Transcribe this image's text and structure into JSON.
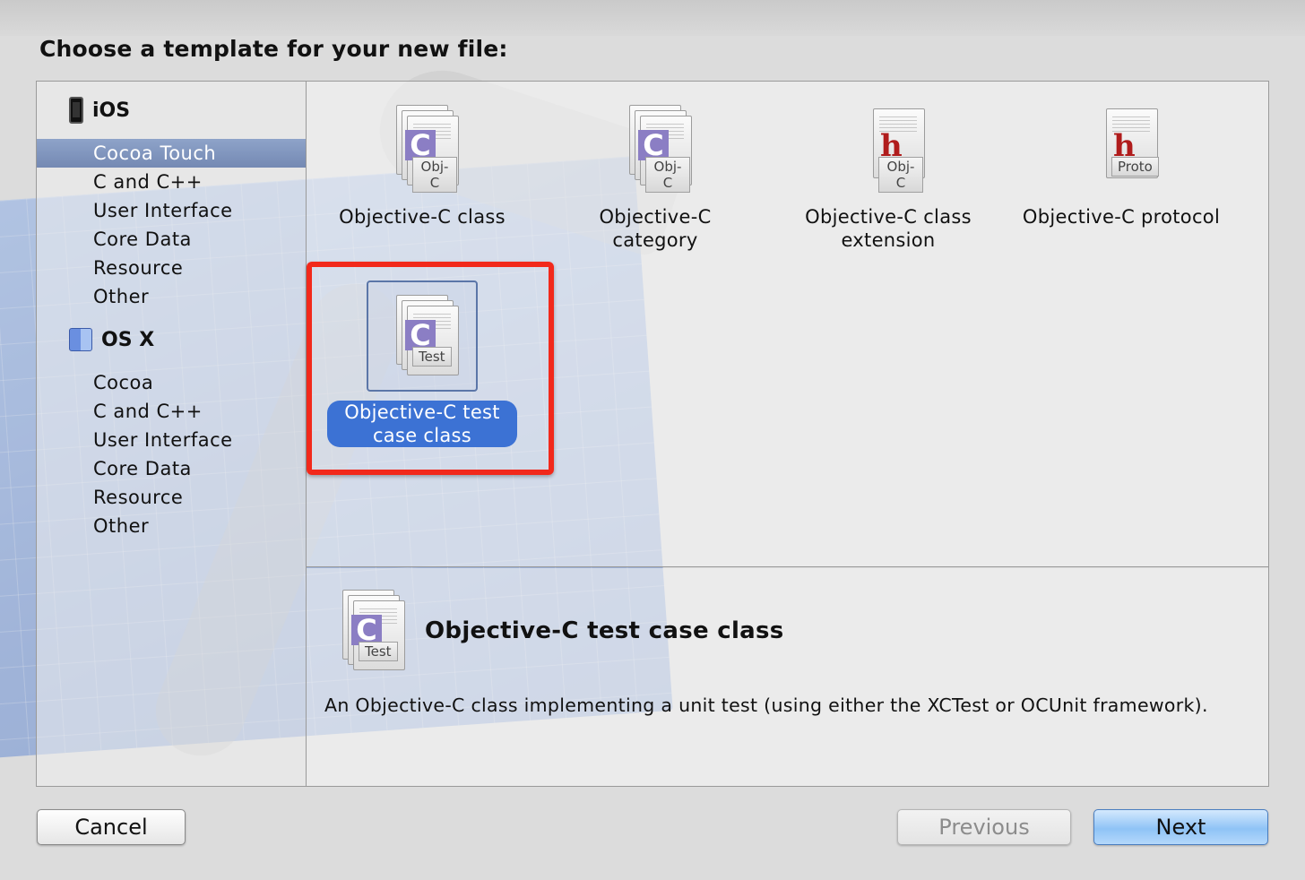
{
  "dialog": {
    "heading": "Choose a template for your new file:"
  },
  "sidebar": {
    "ios": {
      "label": "iOS",
      "items": [
        "Cocoa Touch",
        "C and C++",
        "User Interface",
        "Core Data",
        "Resource",
        "Other"
      ],
      "selected": "Cocoa Touch"
    },
    "osx": {
      "label": "OS X",
      "items": [
        "Cocoa",
        "C and C++",
        "User Interface",
        "Core Data",
        "Resource",
        "Other"
      ]
    }
  },
  "templates": [
    {
      "label": "Objective-C class",
      "icon_tag": "Obj-C",
      "icon": "objc-file-icon"
    },
    {
      "label": "Objective-C category",
      "icon_tag": "Obj-C",
      "icon": "objc-file-icon"
    },
    {
      "label": "Objective-C class extension",
      "icon_tag": "Obj-C",
      "icon": "header-file-icon"
    },
    {
      "label": "Objective-C protocol",
      "icon_tag": "Proto",
      "icon": "header-file-icon"
    },
    {
      "label": "Objective-C test case class",
      "icon_tag": "Test",
      "icon": "objc-file-icon",
      "selected": true
    }
  ],
  "description": {
    "title": "Objective-C test case class",
    "icon_tag": "Test",
    "text": "An Objective-C class implementing a unit test (using either the XCTest or OCUnit framework)."
  },
  "buttons": {
    "cancel": "Cancel",
    "previous": "Previous",
    "next": "Next"
  },
  "colors": {
    "selection_accent": "#3c72d4",
    "highlight_box": "#f2291b",
    "sidebar_selection": "#7f94bd"
  }
}
